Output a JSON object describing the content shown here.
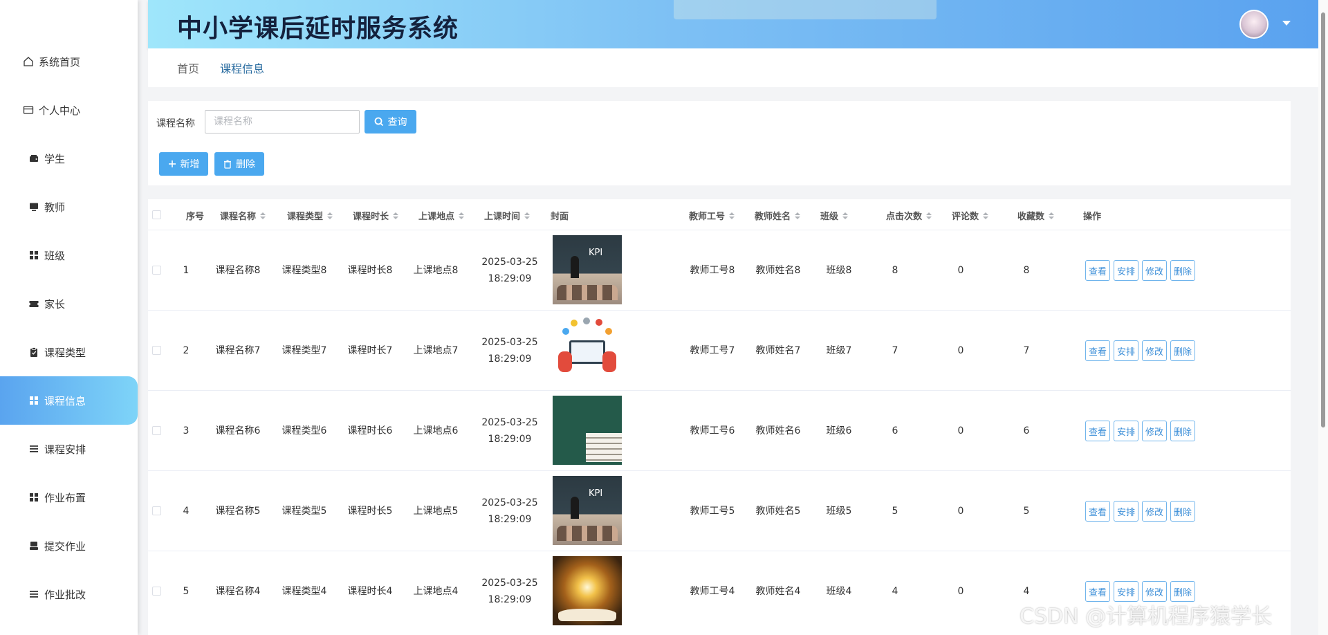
{
  "app": {
    "title": "中小学课后延时服务系统"
  },
  "sidebar": {
    "items": [
      {
        "label": "系统首页",
        "icon": "home-icon",
        "active": false
      },
      {
        "label": "个人中心",
        "icon": "card-icon",
        "active": false
      },
      {
        "label": "学生",
        "icon": "wallet-icon",
        "active": false
      },
      {
        "label": "教师",
        "icon": "monitor-icon",
        "active": false
      },
      {
        "label": "班级",
        "icon": "grid-icon",
        "active": false
      },
      {
        "label": "家长",
        "icon": "ticket-icon",
        "active": false
      },
      {
        "label": "课程类型",
        "icon": "clipboard-icon",
        "active": false
      },
      {
        "label": "课程信息",
        "icon": "grid-icon",
        "active": true
      },
      {
        "label": "课程安排",
        "icon": "list-icon",
        "active": false
      },
      {
        "label": "作业布置",
        "icon": "grid-icon",
        "active": false
      },
      {
        "label": "提交作业",
        "icon": "tray-icon",
        "active": false
      },
      {
        "label": "作业批改",
        "icon": "list-icon",
        "active": false
      }
    ]
  },
  "breadcrumb": {
    "home": "首页",
    "current": "课程信息"
  },
  "search": {
    "label": "课程名称",
    "placeholder": "课程名称",
    "query_button": "查询"
  },
  "toolbar": {
    "add_button": "新增",
    "delete_button": "删除"
  },
  "table": {
    "headers": {
      "index": "序号",
      "course_name": "课程名称",
      "course_type": "课程类型",
      "course_duration": "课程时长",
      "location": "上课地点",
      "time": "上课时间",
      "cover": "封面",
      "teacher_id": "教师工号",
      "teacher_name": "教师姓名",
      "class": "班级",
      "clicks": "点击次数",
      "comments": "评论数",
      "favorites": "收藏数",
      "actions": "操作"
    },
    "action_labels": {
      "view": "查看",
      "schedule": "安排",
      "edit": "修改",
      "delete": "删除"
    },
    "rows": [
      {
        "index": "1",
        "course_name": "课程名称8",
        "course_type": "课程类型8",
        "course_duration": "课程时长8",
        "location": "上课地点8",
        "date": "2025-03-25",
        "clock": "18:29:09",
        "cover": "kpi",
        "teacher_id": "教师工号8",
        "teacher_name": "教师姓名8",
        "class": "班级8",
        "clicks": "8",
        "comments": "0",
        "favorites": "8"
      },
      {
        "index": "2",
        "course_name": "课程名称7",
        "course_type": "课程类型7",
        "course_duration": "课程时长7",
        "location": "上课地点7",
        "date": "2025-03-25",
        "clock": "18:29:09",
        "cover": "elearning",
        "teacher_id": "教师工号7",
        "teacher_name": "教师姓名7",
        "class": "班级7",
        "clicks": "7",
        "comments": "0",
        "favorites": "7"
      },
      {
        "index": "3",
        "course_name": "课程名称6",
        "course_type": "课程类型6",
        "course_duration": "课程时长6",
        "location": "上课地点6",
        "date": "2025-03-25",
        "clock": "18:29:09",
        "cover": "blackboard",
        "teacher_id": "教师工号6",
        "teacher_name": "教师姓名6",
        "class": "班级6",
        "clicks": "6",
        "comments": "0",
        "favorites": "6"
      },
      {
        "index": "4",
        "course_name": "课程名称5",
        "course_type": "课程类型5",
        "course_duration": "课程时长5",
        "location": "上课地点5",
        "date": "2025-03-25",
        "clock": "18:29:09",
        "cover": "kpi",
        "teacher_id": "教师工号5",
        "teacher_name": "教师姓名5",
        "class": "班级5",
        "clicks": "5",
        "comments": "0",
        "favorites": "5"
      },
      {
        "index": "5",
        "course_name": "课程名称4",
        "course_type": "课程类型4",
        "course_duration": "课程时长4",
        "location": "上课地点4",
        "date": "2025-03-25",
        "clock": "18:29:09",
        "cover": "book",
        "teacher_id": "教师工号4",
        "teacher_name": "教师姓名4",
        "class": "班级4",
        "clicks": "4",
        "comments": "0",
        "favorites": "4"
      }
    ]
  },
  "watermark": "CSDN @计算机程序猿学长",
  "colors": {
    "accent": "#4aa8ef",
    "active_menu": "#5aa4ef",
    "header_gradient_start": "#9fe6fb",
    "header_gradient_end": "#5aa2ef"
  }
}
